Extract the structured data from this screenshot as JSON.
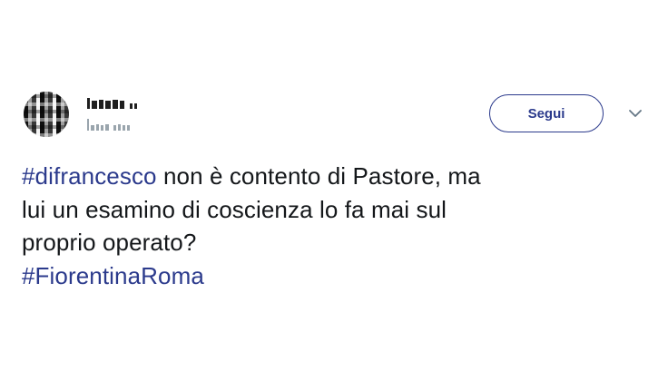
{
  "header": {
    "follow_label": "Segui",
    "menu_icon": "chevron-down-icon",
    "avatar_icon": "blurred-avatar"
  },
  "tweet": {
    "hashtag1": "#difrancesco",
    "line1_rest": " non è contento di Pastore, ma",
    "line2": "lui un esamino di coscienza lo fa mai sul",
    "line3": "proprio operato?",
    "hashtag2": "#FiorentinaRoma"
  },
  "colors": {
    "link": "#2b3a8c",
    "text": "#14171a",
    "handle": "#9aa5ad"
  }
}
